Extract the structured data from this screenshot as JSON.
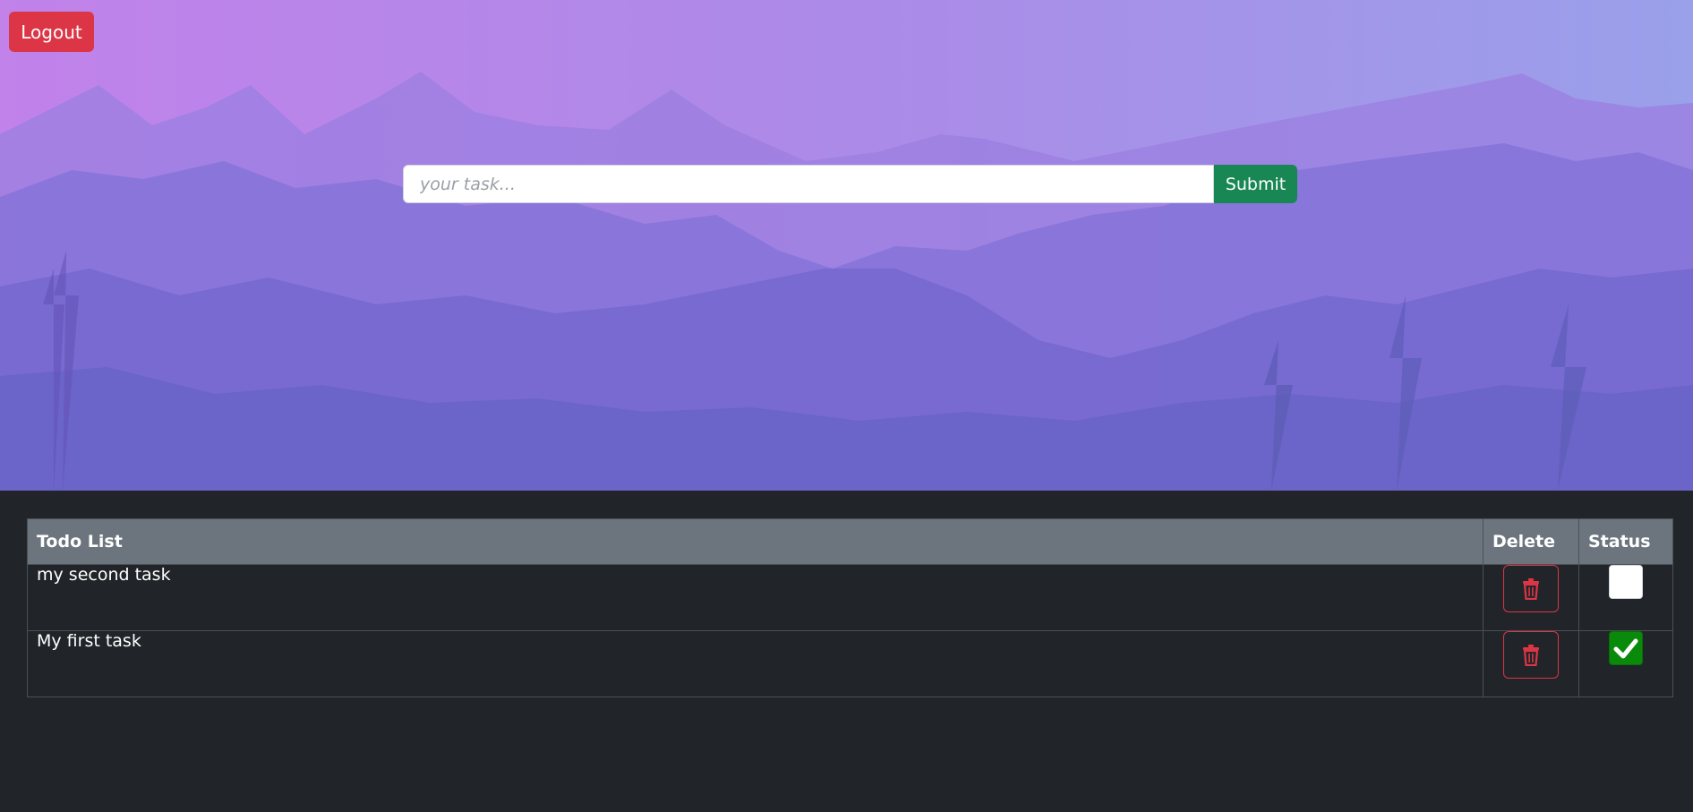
{
  "header": {
    "logout_label": "Logout"
  },
  "form": {
    "placeholder": "your task...",
    "value": "",
    "submit_label": "Submit"
  },
  "table": {
    "headers": {
      "task": "Todo List",
      "delete": "Delete",
      "status": "Status"
    },
    "rows": [
      {
        "task": "my second task",
        "done": false
      },
      {
        "task": "My first task",
        "done": true
      }
    ]
  },
  "colors": {
    "logout": "#dc3545",
    "submit": "#198754",
    "checked": "#0a8a0a",
    "background": "#212529",
    "table_header": "#6c757d"
  },
  "icons": {
    "delete": "trash-icon",
    "checked": "checkmark-icon"
  }
}
